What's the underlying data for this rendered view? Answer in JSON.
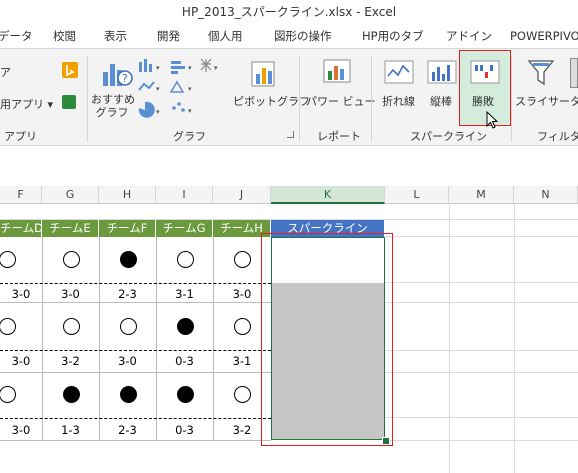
{
  "window": {
    "title": "HP_2013_スパークライン.xlsx - Excel"
  },
  "tabs": [
    "データ",
    "校閲",
    "表示",
    "開発",
    "個人用",
    "図形の操作",
    "HP用のタブ",
    "アドイン",
    "POWERPIVOT"
  ],
  "ribbon": {
    "addins": {
      "store_label": "ア",
      "myapps_label": "用アプリ ▾",
      "group": "アプリ"
    },
    "charts": {
      "recommended": "おすすめ\nグラフ",
      "pivot": "ピボットグラフ",
      "group": "グラフ"
    },
    "reports": {
      "powerview": "パワー ビュー",
      "group": "レポート"
    },
    "sparklines": {
      "line": "折れ線",
      "column": "縦棒",
      "winloss": "勝敗",
      "group": "スパークライン"
    },
    "filters": {
      "slicer": "スライサー",
      "timeline": "タ",
      "group": "フィルター"
    }
  },
  "columns": [
    "F",
    "G",
    "H",
    "I",
    "J",
    "K",
    "L",
    "M",
    "N"
  ],
  "teams": [
    "チームD",
    "チームE",
    "チームF",
    "チームG",
    "チームH"
  ],
  "sparkline_header": "スパークライン",
  "rows": [
    {
      "results": [
        "w",
        "w",
        "b",
        "w",
        "w"
      ],
      "scores": [
        "3-0",
        "3-0",
        "2-3",
        "3-1",
        "3-0"
      ]
    },
    {
      "results": [
        "w",
        "w",
        "w",
        "b",
        "w"
      ],
      "scores": [
        "3-0",
        "3-2",
        "3-0",
        "0-3",
        "3-1"
      ]
    },
    {
      "results": [
        "w",
        "b",
        "b",
        "b",
        "w"
      ],
      "scores": [
        "3-0",
        "1-3",
        "2-3",
        "0-3",
        "3-2"
      ]
    }
  ],
  "colors": {
    "team_header": "#6a9a3d",
    "sparkline_header": "#4472c4",
    "highlight": "#e02020",
    "selection": "#217346"
  }
}
